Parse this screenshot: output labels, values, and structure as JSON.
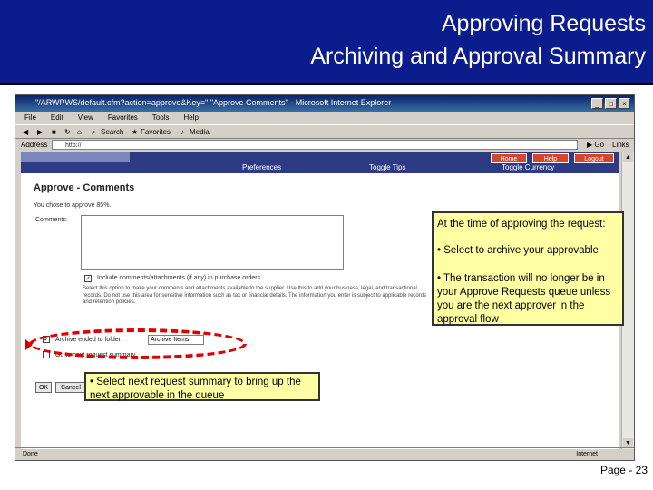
{
  "slide": {
    "title_line1": "Approving Requests",
    "title_line2": "Archiving and Approval Summary",
    "page_number": "Page - 23"
  },
  "browser": {
    "title": "\"/ARWPWS/default.cfm?action=approve&Key=\" \"Approve Comments\" - Microsoft Internet Explorer",
    "menu": [
      "File",
      "Edit",
      "View",
      "Favorites",
      "Tools",
      "Help"
    ],
    "toolbar": {
      "search": "Search",
      "favorites": "Favorites",
      "media": "Media"
    },
    "address_label": "Address",
    "go": "Go",
    "links": "Links",
    "status_done": "Done",
    "status_zone": "Internet"
  },
  "app": {
    "nav": {
      "preferences": "Preferences",
      "toggle_tips": "Toggle Tips",
      "toggle_currency": "Toggle Currency"
    },
    "buttons": {
      "home": "Home",
      "help": "Help",
      "logout": "Logout"
    },
    "page_title": "Approve - Comments",
    "intro": "You chose to approve 85%.",
    "comments_label": "Comments:",
    "include_label": "Include comments/attachments (if any) in purchase orders",
    "fine_print": "Select this option to make your comments and attachments available to the supplier. Use this to add your business, legal, and transactional records. Do not use this area for sensitive information such as tax or financial details. The information you enter is subject to applicable records and retention policies.",
    "archive_label": "Archive ended to folder:",
    "archive_value": "Archive Items",
    "next_label": "Go to next request summary",
    "ok": "OK",
    "cancel": "Cancel"
  },
  "callouts": {
    "archive_intro": "At the time of approving the request:",
    "archive_bullet": "• Select to archive your approvable",
    "archive_note": "• The transaction will no longer be in your Approve Requests queue unless you are the next approver in the approval flow",
    "next_bullet": "• Select next request summary to bring up the next approvable in the queue"
  }
}
